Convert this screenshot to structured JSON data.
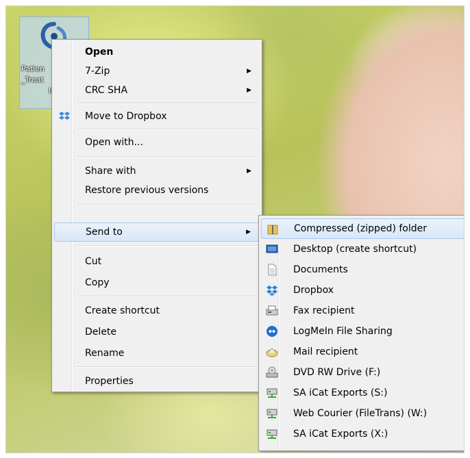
{
  "desktop_icon": {
    "label_lines": [
      "Patien",
      "_Treat",
      "la"
    ]
  },
  "context_menu": {
    "open": "Open",
    "seven_zip": "7-Zip",
    "crc_sha": "CRC SHA",
    "move_to_dropbox": "Move to Dropbox",
    "open_with": "Open with...",
    "share_with": "Share with",
    "restore_previous_versions": "Restore previous versions",
    "send_to": "Send to",
    "cut": "Cut",
    "copy": "Copy",
    "create_shortcut": "Create shortcut",
    "delete": "Delete",
    "rename": "Rename",
    "properties": "Properties"
  },
  "send_to_menu": {
    "items": [
      {
        "label": "Compressed (zipped) folder",
        "icon": "zip-folder-icon"
      },
      {
        "label": "Desktop (create shortcut)",
        "icon": "desktop-icon"
      },
      {
        "label": "Documents",
        "icon": "documents-icon"
      },
      {
        "label": "Dropbox",
        "icon": "dropbox-icon"
      },
      {
        "label": "Fax recipient",
        "icon": "fax-icon"
      },
      {
        "label": "LogMeIn File Sharing",
        "icon": "logmein-icon"
      },
      {
        "label": "Mail recipient",
        "icon": "mail-icon"
      },
      {
        "label": "DVD RW Drive (F:)",
        "icon": "dvd-drive-icon"
      },
      {
        "label": "SA iCat Exports (S:)",
        "icon": "network-drive-icon"
      },
      {
        "label": "Web Courier (FileTrans) (W:)",
        "icon": "network-drive-icon"
      },
      {
        "label": "SA iCat Exports (X:)",
        "icon": "network-drive-icon"
      }
    ]
  },
  "colors": {
    "highlight": "#d9e7f7",
    "menu_bg": "#f0f0f0",
    "dropbox_blue": "#2d7fd3"
  }
}
